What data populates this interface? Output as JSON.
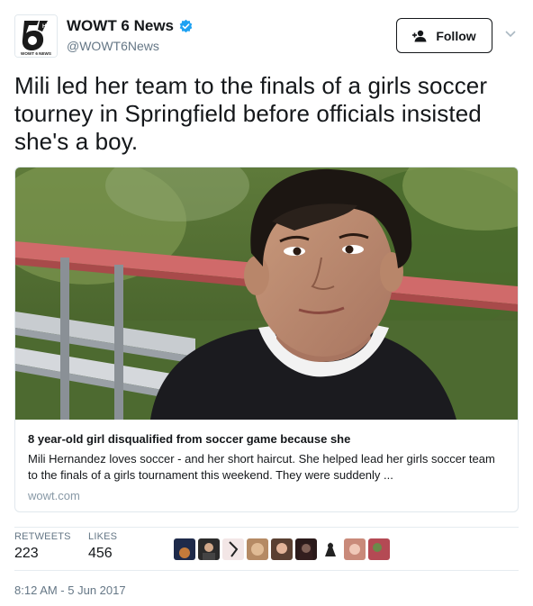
{
  "header": {
    "display_name": "WOWT 6 News",
    "handle": "@WOWT6News",
    "avatar_text": "WOWT 6 NEWS",
    "avatar_hd": "HD"
  },
  "follow_button": {
    "label": "Follow"
  },
  "tweet": {
    "text": "Mili led her team to the finals of a girls soccer tourney in Springfield before officials insisted she's a boy."
  },
  "card": {
    "title": "8 year-old girl disqualified from soccer game because she",
    "description": "Mili Hernandez loves soccer - and her short haircut. She helped lead her girls soccer team to the finals of a girls tournament this weekend. They were suddenly ...",
    "domain": "wowt.com"
  },
  "stats": {
    "retweets_label": "RETWEETS",
    "retweets_value": "223",
    "likes_label": "LIKES",
    "likes_value": "456"
  },
  "timestamp": "8:12 AM - 5 Jun 2017",
  "colors": {
    "accent": "#1da1f2",
    "verified": "#1da1f2",
    "text": "#14171a",
    "muted": "#657786"
  }
}
